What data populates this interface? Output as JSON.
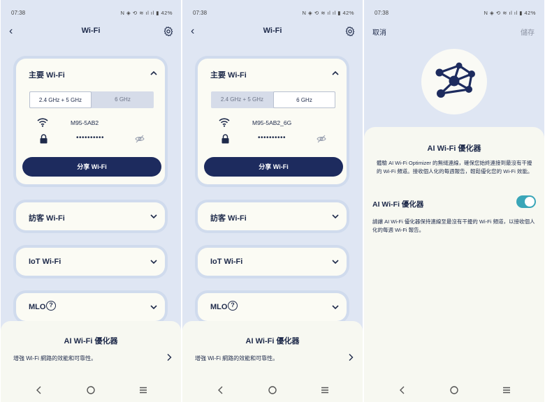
{
  "colors": {
    "accent": "#1d2b5e",
    "toggle_on": "#3aa6b8",
    "background": "#dfe6f3",
    "card": "#fbfbf4"
  },
  "status": {
    "time": "07:38",
    "icons": "N ◈ ⟲ ≋ ıl ıl ▮ 42%"
  },
  "screens": [
    {
      "header": {
        "back_icon": "‹",
        "title": "Wi-Fi"
      },
      "main_wifi": {
        "title": "主要  Wi-Fi",
        "band_a": "2.4 GHz + 5 GHz",
        "band_b": "6 GHz",
        "ssid": "M95-5AB2",
        "password": "••••••••••",
        "share": "分享 Wi-Fi"
      },
      "guest": "訪客  Wi-Fi",
      "iot": "IoT Wi-Fi",
      "mlo": "MLO",
      "mlo_help": "?",
      "bottom": {
        "title": "AI Wi-Fi 優化器",
        "desc": "增強 Wi-Fi 網路的效能和可靠性。"
      }
    },
    {
      "header": {
        "back_icon": "‹",
        "title": "Wi-Fi"
      },
      "main_wifi": {
        "title": "主要  Wi-Fi",
        "band_a": "2.4 GHz + 5 GHz",
        "band_b": "6 GHz",
        "ssid": "M95-5AB2_6G",
        "password": "••••••••••",
        "share": "分享 Wi-Fi"
      },
      "guest": "訪客  Wi-Fi",
      "iot": "IoT Wi-Fi",
      "mlo": "MLO",
      "mlo_help": "?",
      "bottom": {
        "title": "AI Wi-Fi 優化器",
        "desc": "增強 Wi-Fi 網路的效能和可靠性。"
      }
    }
  ],
  "optimizer": {
    "cancel": "取消",
    "save": "儲存",
    "title": "AI Wi-Fi 優化器",
    "description": "體驗 AI Wi-Fi Optimizer 的無縫連線，確保您始終連接到最沒有干擾的 Wi-Fi 頻道。接收個人化的每週報告，輕鬆優化您的 Wi-Fi 效能。",
    "toggle_label": "AI Wi-Fi 優化器",
    "toggle_on": true,
    "toggle_desc": "請讓 AI Wi-Fi 優化器保持連線至最沒有干擾的 Wi-Fi 頻道，以接收個人化的每週 Wi-Fi 報告。"
  }
}
